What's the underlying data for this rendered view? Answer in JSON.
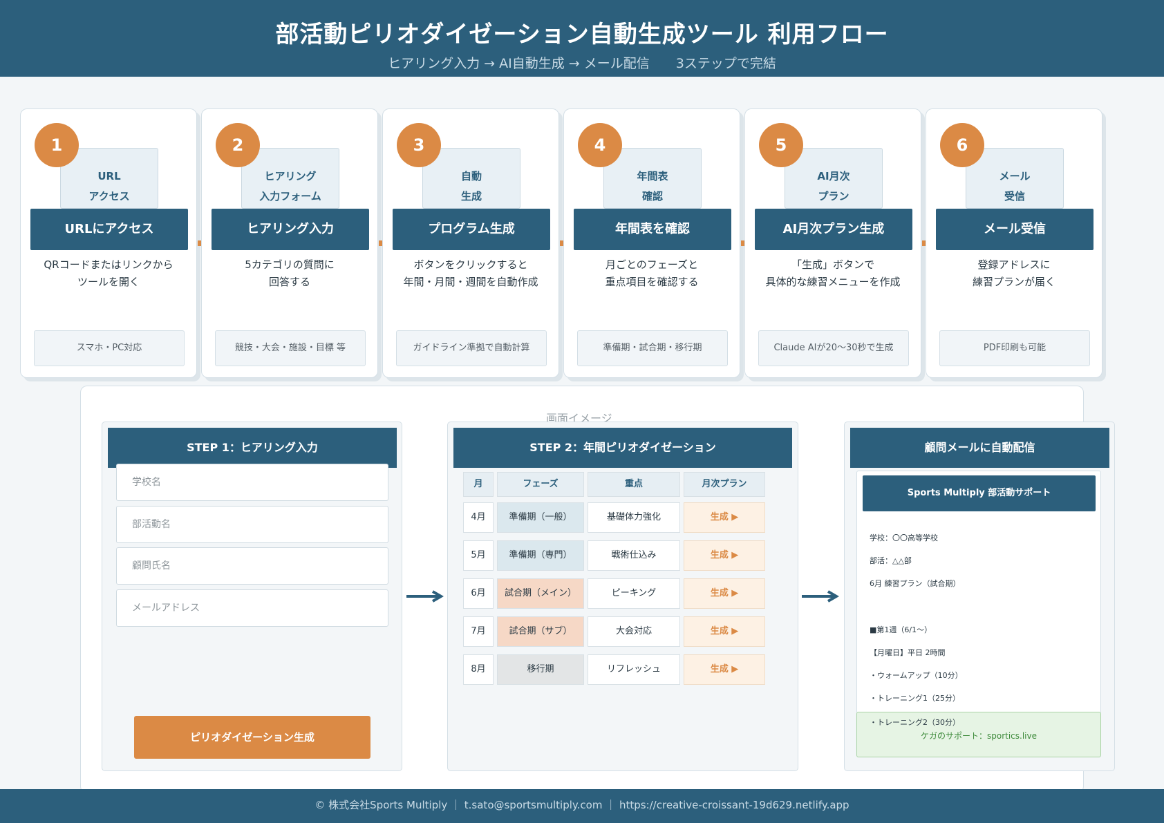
{
  "header": {
    "title": "部活動ピリオダイゼーション自動生成ツール 利用フロー",
    "subtitle": "ヒアリング入力 → AI自動生成 → メール配信　　3ステップで完結"
  },
  "steps": [
    {
      "num": "1",
      "icon_line1": "URL",
      "icon_line2": "アクセス",
      "label": "URLにアクセス",
      "desc": "QRコードまたはリンクから\nツールを開く",
      "tag": "スマホ・PC対応"
    },
    {
      "num": "2",
      "icon_line1": "ヒアリング",
      "icon_line2": "入力フォーム",
      "label": "ヒアリング入力",
      "desc": "5カテゴリの質問に\n回答する",
      "tag": "競技・大会・施設・目標 等"
    },
    {
      "num": "3",
      "icon_line1": "自動",
      "icon_line2": "生成",
      "label": "プログラム生成",
      "desc": "ボタンをクリックすると\n年間・月間・週間を自動作成",
      "tag": "ガイドライン準拠で自動計算"
    },
    {
      "num": "4",
      "icon_line1": "年間表",
      "icon_line2": "確認",
      "label": "年間表を確認",
      "desc": "月ごとのフェーズと\n重点項目を確認する",
      "tag": "準備期・試合期・移行期"
    },
    {
      "num": "5",
      "icon_line1": "AI月次",
      "icon_line2": "プラン",
      "label": "AI月次プラン生成",
      "desc": "「生成」ボタンで\n具体的な練習メニューを作成",
      "tag": "Claude AIが20〜30秒で生成"
    },
    {
      "num": "6",
      "icon_line1": "メール",
      "icon_line2": "受信",
      "label": "メール受信",
      "desc": "登録アドレスに\n練習プランが届く",
      "tag": "PDF印刷も可能"
    }
  ],
  "screen_caption": "画面イメージ",
  "step1": {
    "title": "STEP 1：ヒアリング入力",
    "fields": [
      "学校名",
      "部活動名",
      "顧問氏名",
      "メールアドレス"
    ],
    "button": "ピリオダイゼーション生成"
  },
  "step2": {
    "title": "STEP 2：年間ピリオダイゼーション",
    "headers": [
      "月",
      "フェーズ",
      "重点",
      "月次プラン"
    ],
    "rows": [
      {
        "month": "4月",
        "phase": "準備期（一般）",
        "focus": "基礎体力強化",
        "plan": "生成 ▶"
      },
      {
        "month": "5月",
        "phase": "準備期（専門）",
        "focus": "戦術仕込み",
        "plan": "生成 ▶"
      },
      {
        "month": "6月",
        "phase": "試合期（メイン）",
        "focus": "ピーキング",
        "plan": "生成 ▶"
      },
      {
        "month": "7月",
        "phase": "試合期（サブ）",
        "focus": "大会対応",
        "plan": "生成 ▶"
      },
      {
        "month": "8月",
        "phase": "移行期",
        "focus": "リフレッシュ",
        "plan": "生成 ▶"
      }
    ]
  },
  "step3": {
    "title": "顧問メールに自動配信",
    "mail_header": "Sports Multiply 部活動サポート",
    "lines": [
      "学校：〇〇高等学校",
      "部活：△△部",
      "6月 練習プラン（試合期）",
      "■第1週（6/1〜）",
      "【月曜日】平日 2時間",
      "・ウォームアップ（10分）",
      "・トレーニング1（25分）"
    ],
    "overflow_line": "・トレーニング2（30分）",
    "link": "ケガのサポート：sportics.live"
  },
  "footer": "© 株式会社Sports Multiply ｜ t.sato@sportsmultiply.com ｜ https://creative-croissant-19d629.netlify.app",
  "colors": {
    "primary": "#2c5f7c",
    "accent": "#db8a45",
    "preparation": "#dbe8ee",
    "competition": "#f6d8c6",
    "transition": "#e3e5e6"
  }
}
